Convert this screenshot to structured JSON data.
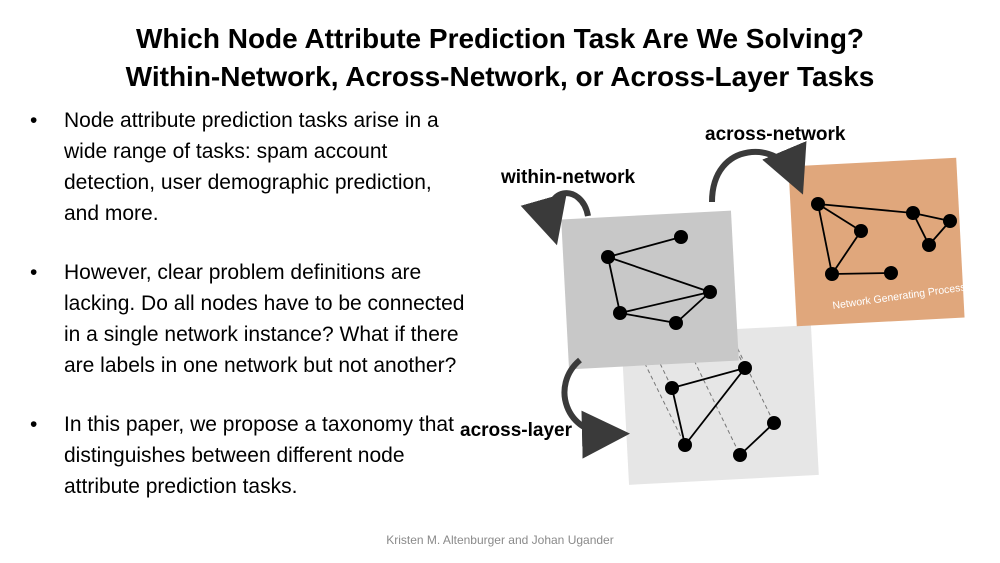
{
  "title": {
    "line1": "Which Node Attribute Prediction Task Are We Solving?",
    "line2": "Within-Network, Across-Network, or Across-Layer Tasks"
  },
  "bullets": [
    "Node attribute prediction tasks arise in a wide range of tasks: spam account detection, user demographic prediction, and more.",
    "However, clear problem definitions are lacking. Do all nodes have to be connected in a single network instance? What if there are labels in one network but not another?",
    "In this paper, we propose a taxonomy that distinguishes between different node attribute prediction tasks."
  ],
  "diagram": {
    "labels": {
      "within_network": "within-network",
      "across_network": "across-network",
      "across_layer": "across-layer",
      "network_generating_process": "Network Generating Process"
    },
    "colors": {
      "main_layer": "#c8c8c8",
      "lower_layer": "#e6e6e6",
      "generating_process": "#e0a77c",
      "arrow": "#3a3a3a",
      "node": "#000000"
    }
  },
  "footer": "Kristen M. Altenburger and Johan Ugander"
}
